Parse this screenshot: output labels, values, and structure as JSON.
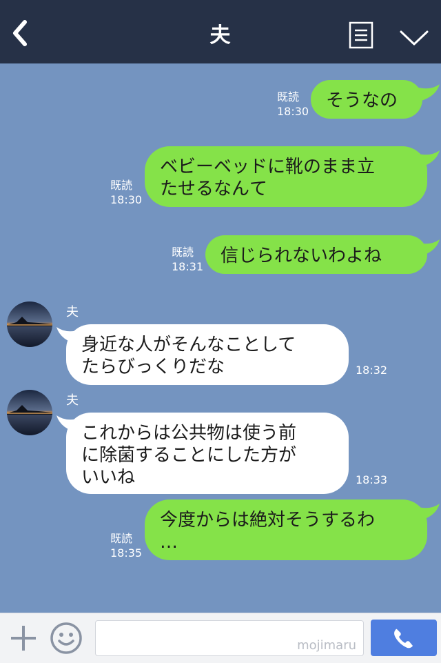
{
  "header": {
    "title": "夫"
  },
  "messages": [
    {
      "side": "right",
      "read": "既読",
      "time": "18:30",
      "text": "そうなの"
    },
    {
      "side": "right",
      "read": "既読",
      "time": "18:30",
      "text": "ベビーベッドに靴のまま立\nたせるなんて"
    },
    {
      "side": "right",
      "read": "既読",
      "time": "18:31",
      "text": "信じられないわよね"
    },
    {
      "side": "left",
      "sender": "夫",
      "time": "18:32",
      "text": "身近な人がそんなことして\nたらびっくりだな"
    },
    {
      "side": "left",
      "sender": "夫",
      "time": "18:33",
      "text": "これからは公共物は使う前\nに除菌することにした方が\nいいね"
    },
    {
      "side": "right",
      "read": "既読",
      "time": "18:35",
      "text": "今度からは絶対そうするわ\n…"
    }
  ],
  "footer": {
    "watermark": "mojimaru"
  },
  "icons": {
    "back": "chevron-left-icon",
    "menu": "notes-icon",
    "collapse": "chevron-down-icon",
    "add": "plus-icon",
    "emoji": "smile-icon",
    "call": "phone-icon"
  },
  "colors": {
    "header_bg": "#263147",
    "chat_bg": "#7494c0",
    "my_bubble": "#85e249",
    "their_bubble": "#ffffff",
    "call_button": "#4f7ee0"
  }
}
